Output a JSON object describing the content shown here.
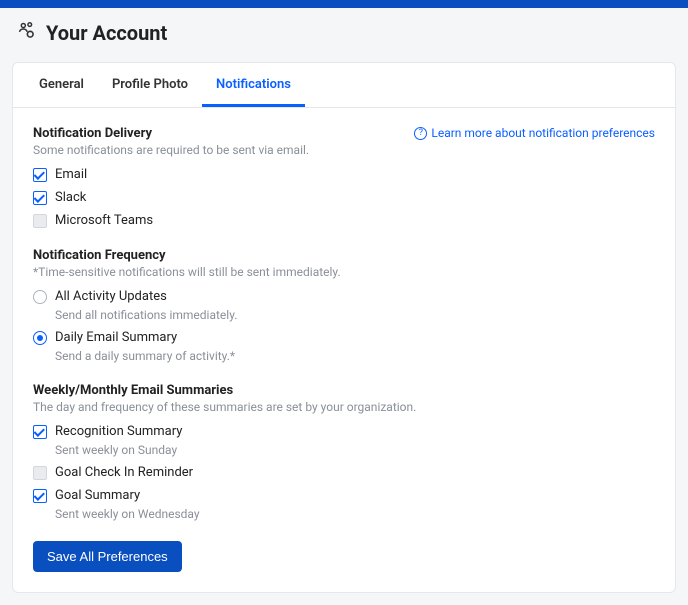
{
  "page_title": "Your Account",
  "tabs": {
    "general": "General",
    "photo": "Profile Photo",
    "notifications": "Notifications"
  },
  "learn_more": "Learn more about notification preferences",
  "delivery": {
    "title": "Notification Delivery",
    "subtitle": "Some notifications are required to be sent via email.",
    "email": "Email",
    "slack": "Slack",
    "teams": "Microsoft Teams"
  },
  "frequency": {
    "title": "Notification Frequency",
    "subtitle": "*Time-sensitive notifications will still be sent immediately.",
    "all_label": "All Activity Updates",
    "all_desc": "Send all notifications immediately.",
    "daily_label": "Daily Email Summary",
    "daily_desc": "Send a daily summary of activity.*"
  },
  "weekly": {
    "title": "Weekly/Monthly Email Summaries",
    "subtitle": "The day and frequency of these summaries are set by your organization.",
    "recog_label": "Recognition Summary",
    "recog_desc": "Sent weekly on Sunday",
    "checkin_label": "Goal Check In Reminder",
    "goal_label": "Goal Summary",
    "goal_desc": "Sent weekly on Wednesday"
  },
  "save_button": "Save All Preferences"
}
